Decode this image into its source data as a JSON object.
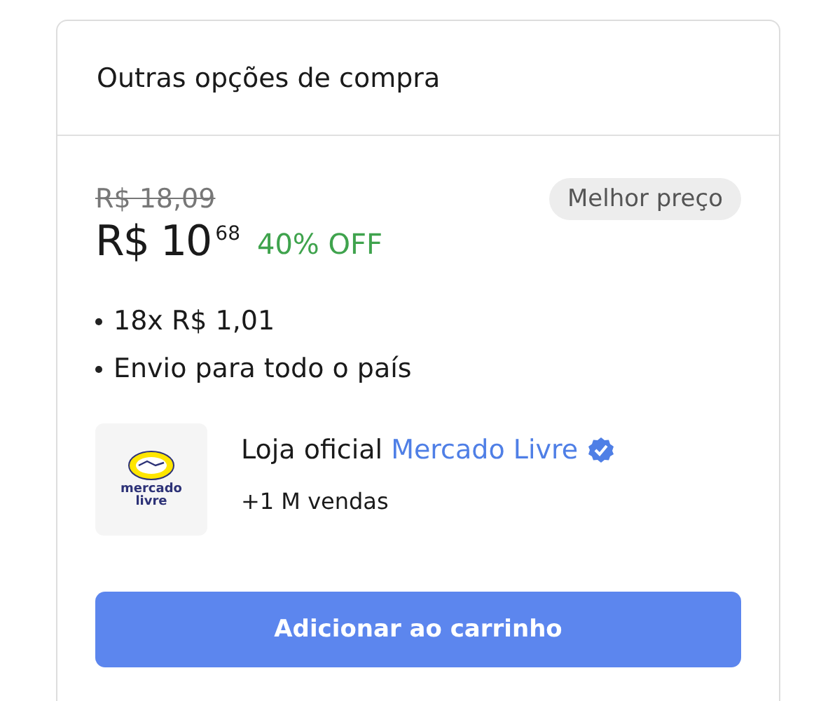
{
  "card": {
    "title": "Outras opções de compra"
  },
  "offer": {
    "original_price": "R$ 18,09",
    "price_main": "R$ 10",
    "price_cents": "68",
    "discount": "40% OFF",
    "badge": "Melhor preço",
    "features": [
      "18x R$ 1,01",
      "Envio para todo o país"
    ],
    "seller": {
      "logo_lines": [
        "mercado",
        "livre"
      ],
      "prefix": "Loja oficial",
      "name": "Mercado Livre",
      "verified": true,
      "sales": "+1 M vendas"
    },
    "button": "Adicionar ao carrinho"
  }
}
